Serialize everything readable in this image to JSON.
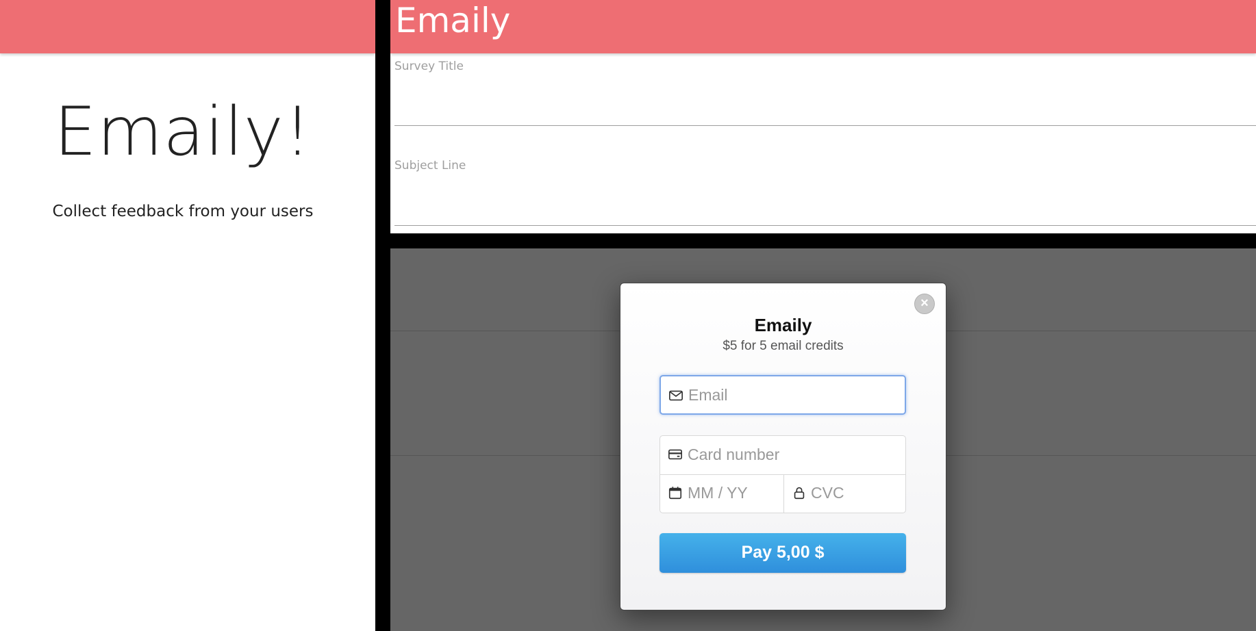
{
  "left": {
    "hero_title": "Emaily!",
    "hero_subtitle": "Collect feedback from your users"
  },
  "top_right": {
    "brand": "Emaily",
    "fields": [
      {
        "label": "Survey Title",
        "value": ""
      },
      {
        "label": "Subject Line",
        "value": ""
      }
    ]
  },
  "checkout": {
    "title": "Emaily",
    "description": "$5 for 5 email credits",
    "email_placeholder": "Email",
    "card_placeholder": "Card number",
    "expiry_placeholder": "MM / YY",
    "cvc_placeholder": "CVC",
    "pay_label": "Pay 5,00 $",
    "close_icon": "close-icon"
  },
  "colors": {
    "navbar": "#ee6e73",
    "pay_button": "#3a9fe4",
    "overlay": "#666666"
  }
}
